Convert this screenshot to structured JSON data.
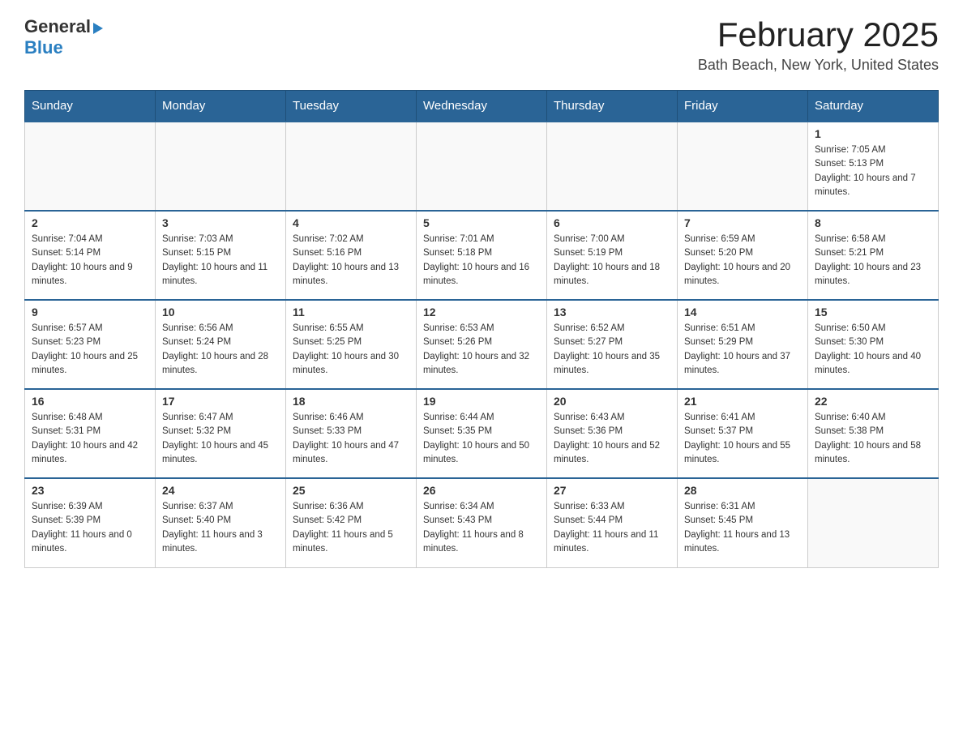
{
  "header": {
    "logo_general": "General",
    "logo_blue": "Blue",
    "month_title": "February 2025",
    "location": "Bath Beach, New York, United States"
  },
  "weekdays": [
    "Sunday",
    "Monday",
    "Tuesday",
    "Wednesday",
    "Thursday",
    "Friday",
    "Saturday"
  ],
  "weeks": [
    [
      {
        "day": "",
        "info": ""
      },
      {
        "day": "",
        "info": ""
      },
      {
        "day": "",
        "info": ""
      },
      {
        "day": "",
        "info": ""
      },
      {
        "day": "",
        "info": ""
      },
      {
        "day": "",
        "info": ""
      },
      {
        "day": "1",
        "info": "Sunrise: 7:05 AM\nSunset: 5:13 PM\nDaylight: 10 hours and 7 minutes."
      }
    ],
    [
      {
        "day": "2",
        "info": "Sunrise: 7:04 AM\nSunset: 5:14 PM\nDaylight: 10 hours and 9 minutes."
      },
      {
        "day": "3",
        "info": "Sunrise: 7:03 AM\nSunset: 5:15 PM\nDaylight: 10 hours and 11 minutes."
      },
      {
        "day": "4",
        "info": "Sunrise: 7:02 AM\nSunset: 5:16 PM\nDaylight: 10 hours and 13 minutes."
      },
      {
        "day": "5",
        "info": "Sunrise: 7:01 AM\nSunset: 5:18 PM\nDaylight: 10 hours and 16 minutes."
      },
      {
        "day": "6",
        "info": "Sunrise: 7:00 AM\nSunset: 5:19 PM\nDaylight: 10 hours and 18 minutes."
      },
      {
        "day": "7",
        "info": "Sunrise: 6:59 AM\nSunset: 5:20 PM\nDaylight: 10 hours and 20 minutes."
      },
      {
        "day": "8",
        "info": "Sunrise: 6:58 AM\nSunset: 5:21 PM\nDaylight: 10 hours and 23 minutes."
      }
    ],
    [
      {
        "day": "9",
        "info": "Sunrise: 6:57 AM\nSunset: 5:23 PM\nDaylight: 10 hours and 25 minutes."
      },
      {
        "day": "10",
        "info": "Sunrise: 6:56 AM\nSunset: 5:24 PM\nDaylight: 10 hours and 28 minutes."
      },
      {
        "day": "11",
        "info": "Sunrise: 6:55 AM\nSunset: 5:25 PM\nDaylight: 10 hours and 30 minutes."
      },
      {
        "day": "12",
        "info": "Sunrise: 6:53 AM\nSunset: 5:26 PM\nDaylight: 10 hours and 32 minutes."
      },
      {
        "day": "13",
        "info": "Sunrise: 6:52 AM\nSunset: 5:27 PM\nDaylight: 10 hours and 35 minutes."
      },
      {
        "day": "14",
        "info": "Sunrise: 6:51 AM\nSunset: 5:29 PM\nDaylight: 10 hours and 37 minutes."
      },
      {
        "day": "15",
        "info": "Sunrise: 6:50 AM\nSunset: 5:30 PM\nDaylight: 10 hours and 40 minutes."
      }
    ],
    [
      {
        "day": "16",
        "info": "Sunrise: 6:48 AM\nSunset: 5:31 PM\nDaylight: 10 hours and 42 minutes."
      },
      {
        "day": "17",
        "info": "Sunrise: 6:47 AM\nSunset: 5:32 PM\nDaylight: 10 hours and 45 minutes."
      },
      {
        "day": "18",
        "info": "Sunrise: 6:46 AM\nSunset: 5:33 PM\nDaylight: 10 hours and 47 minutes."
      },
      {
        "day": "19",
        "info": "Sunrise: 6:44 AM\nSunset: 5:35 PM\nDaylight: 10 hours and 50 minutes."
      },
      {
        "day": "20",
        "info": "Sunrise: 6:43 AM\nSunset: 5:36 PM\nDaylight: 10 hours and 52 minutes."
      },
      {
        "day": "21",
        "info": "Sunrise: 6:41 AM\nSunset: 5:37 PM\nDaylight: 10 hours and 55 minutes."
      },
      {
        "day": "22",
        "info": "Sunrise: 6:40 AM\nSunset: 5:38 PM\nDaylight: 10 hours and 58 minutes."
      }
    ],
    [
      {
        "day": "23",
        "info": "Sunrise: 6:39 AM\nSunset: 5:39 PM\nDaylight: 11 hours and 0 minutes."
      },
      {
        "day": "24",
        "info": "Sunrise: 6:37 AM\nSunset: 5:40 PM\nDaylight: 11 hours and 3 minutes."
      },
      {
        "day": "25",
        "info": "Sunrise: 6:36 AM\nSunset: 5:42 PM\nDaylight: 11 hours and 5 minutes."
      },
      {
        "day": "26",
        "info": "Sunrise: 6:34 AM\nSunset: 5:43 PM\nDaylight: 11 hours and 8 minutes."
      },
      {
        "day": "27",
        "info": "Sunrise: 6:33 AM\nSunset: 5:44 PM\nDaylight: 11 hours and 11 minutes."
      },
      {
        "day": "28",
        "info": "Sunrise: 6:31 AM\nSunset: 5:45 PM\nDaylight: 11 hours and 13 minutes."
      },
      {
        "day": "",
        "info": ""
      }
    ]
  ]
}
